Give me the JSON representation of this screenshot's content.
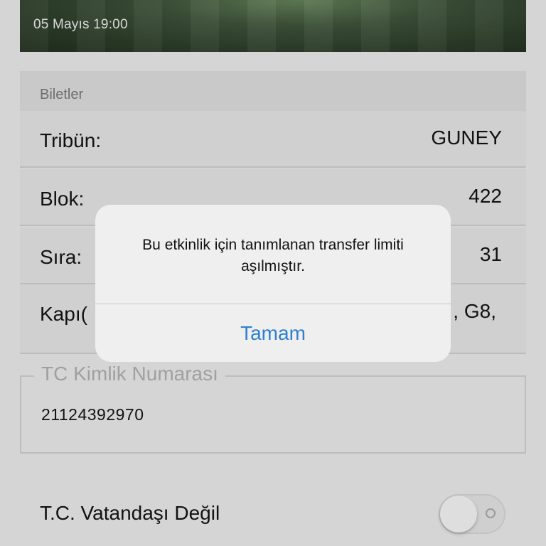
{
  "event": {
    "date": "05 Mayıs 19:00"
  },
  "tickets": {
    "section_title": "Biletler",
    "rows": [
      {
        "label": "Tribün:",
        "value": "GUNEY"
      },
      {
        "label": "Blok:",
        "value": "422"
      },
      {
        "label": "Sıra:",
        "value": "31"
      },
      {
        "label": "Kapı(",
        "value": ", G8,"
      }
    ]
  },
  "tc_field": {
    "legend": "TC Kimlik Numarası",
    "value": "21124392970"
  },
  "toggle": {
    "label": "T.C. Vatandaşı Değil",
    "state": "off"
  },
  "alert": {
    "message": "Bu etkinlik için tanımlanan transfer limiti aşılmıştır.",
    "button_label": "Tamam"
  },
  "colors": {
    "accent": "#2f7fd6"
  }
}
